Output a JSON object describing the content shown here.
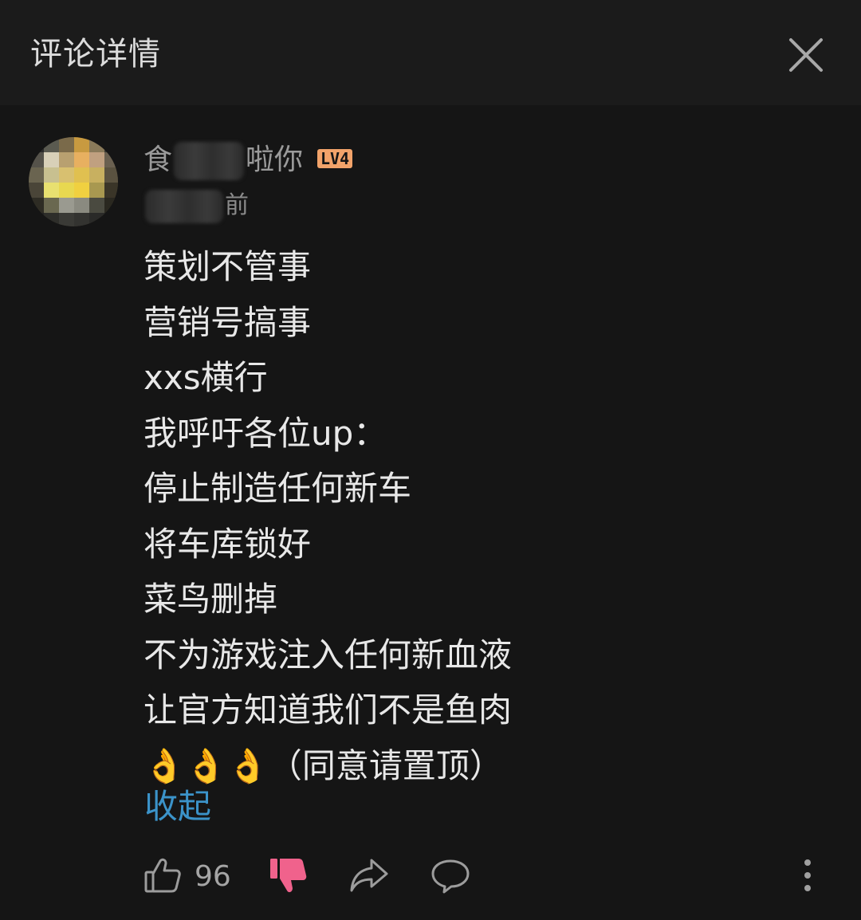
{
  "header": {
    "title": "评论详情",
    "close_icon": "close-icon"
  },
  "comment": {
    "username_start": "食",
    "username_end": "啦你",
    "level": "LV4",
    "time_suffix": "前",
    "lines": [
      "策划不管事",
      "营销号搞事",
      "xxs横行",
      "我呼吁各位up：",
      "停止制造任何新车",
      "将车库锁好",
      "菜鸟删掉",
      "不为游戏注入任何新血液",
      "让官方知道我们不是鱼肉",
      "👌👌👌（同意请置顶）"
    ],
    "collapse_label": "收起"
  },
  "actions": {
    "like_count": "96",
    "like_icon": "thumbs-up-icon",
    "dislike_icon": "thumbs-down-icon",
    "share_icon": "share-icon",
    "reply_icon": "reply-bubble-icon",
    "more_icon": "more-vertical-icon",
    "dislike_color": "#f0628c"
  },
  "colors": {
    "background": "#151515",
    "header_background": "#1b1b1b",
    "link": "#3b93c9",
    "level_badge": "#f2a36a"
  }
}
